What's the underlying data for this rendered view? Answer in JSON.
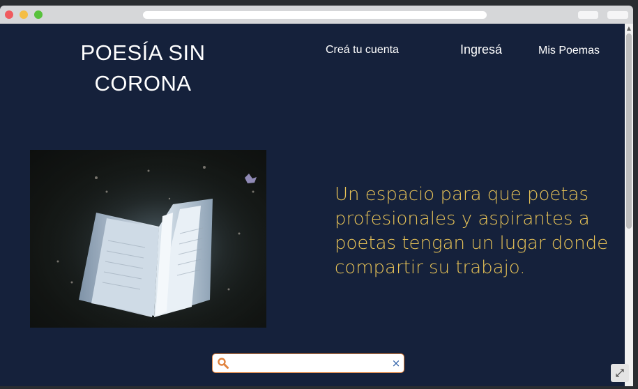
{
  "header": {
    "brand_line1": "POESÍA SIN",
    "brand_line2": "CORONA",
    "nav": {
      "signup": "Creá tu cuenta",
      "login": "Ingresá",
      "poems": "Mis Poemas"
    }
  },
  "hero": {
    "tagline": "Un espacio para que poetas profesionales y aspirantes a poetas tengan un lugar donde compartir su trabajo.",
    "image": "open-book-photo"
  },
  "search": {
    "value": "",
    "placeholder": "",
    "icon": "search-icon",
    "clear": "×"
  },
  "colors": {
    "page_background": "#15213b",
    "tagline": "#e8c357",
    "search_border": "#e0823d",
    "search_icon": "#e0823d",
    "clear_icon": "#2d5fa8"
  }
}
